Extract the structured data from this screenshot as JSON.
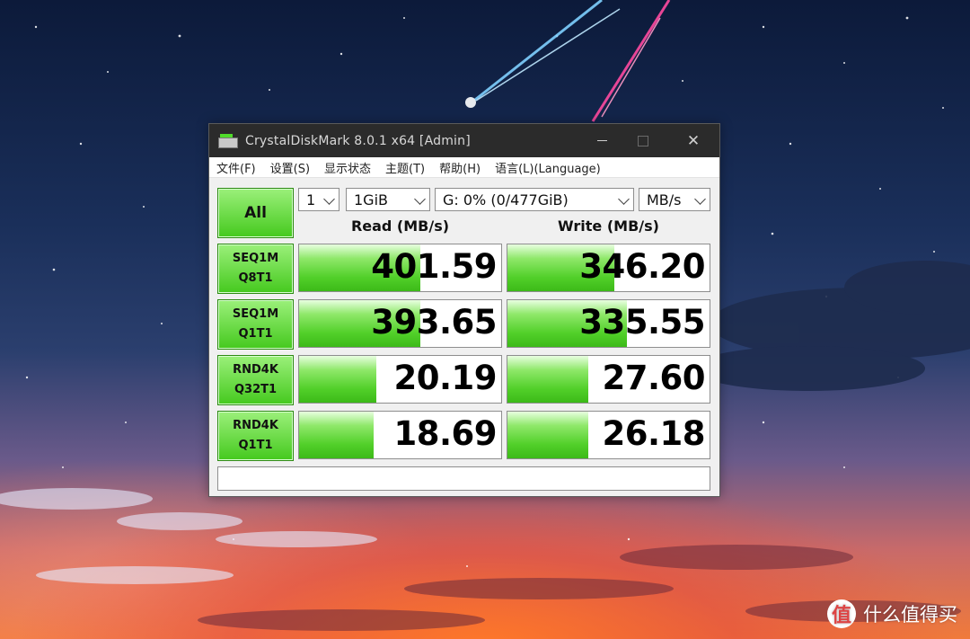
{
  "window": {
    "title": "CrystalDiskMark 8.0.1 x64 [Admin]",
    "close_glyph": "✕"
  },
  "menu": [
    "文件(F)",
    "设置(S)",
    "显示状态",
    "主题(T)",
    "帮助(H)",
    "语言(L)(Language)"
  ],
  "controls": {
    "all_label": "All",
    "count": "1",
    "size": "1GiB",
    "drive": "G: 0% (0/477GiB)",
    "unit": "MB/s"
  },
  "headers": {
    "read": "Read (MB/s)",
    "write": "Write (MB/s)"
  },
  "tests": [
    {
      "line1": "SEQ1M",
      "line2": "Q8T1",
      "read": "401.59",
      "write": "346.20",
      "read_fill": 0.6,
      "write_fill": 0.53
    },
    {
      "line1": "SEQ1M",
      "line2": "Q1T1",
      "read": "393.65",
      "write": "335.55",
      "read_fill": 0.6,
      "write_fill": 0.59
    },
    {
      "line1": "RND4K",
      "line2": "Q32T1",
      "read": "20.19",
      "write": "27.60",
      "read_fill": 0.38,
      "write_fill": 0.4
    },
    {
      "line1": "RND4K",
      "line2": "Q1T1",
      "read": "18.69",
      "write": "26.18",
      "read_fill": 0.37,
      "write_fill": 0.4
    }
  ],
  "comment": "",
  "watermark": {
    "logo_glyph": "值",
    "text": "什么值得买"
  },
  "colors": {
    "accent_green": "#45c91e",
    "titlebar": "#2b2b2b"
  }
}
